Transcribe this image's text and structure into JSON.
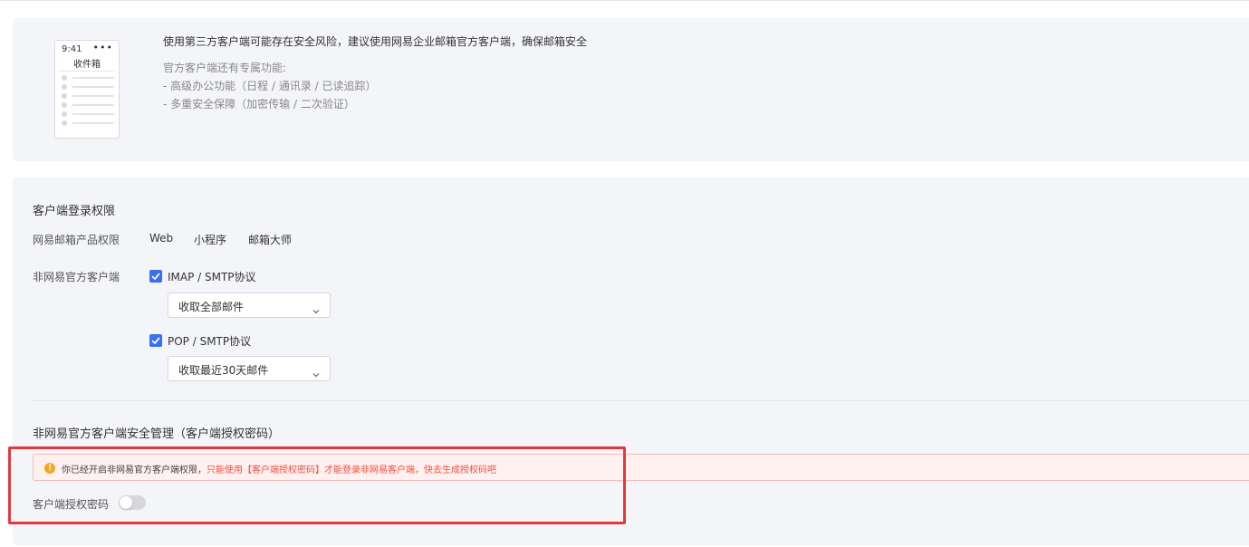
{
  "recommend": {
    "phone": {
      "time": "9:41",
      "menu": "•••",
      "title": "收件箱"
    },
    "headline": "使用第三方客户端可能存在安全风险，建议使用网易企业邮箱官方客户端，确保邮箱安全",
    "features_intro": "官方客户端还有专属功能:",
    "features": [
      "- 高级办公功能（日程 / 通讯录 / 已读追踪）",
      "- 多重安全保障（加密传输 / 二次验证）"
    ]
  },
  "login_permissions": {
    "title": "客户端登录权限",
    "product_label": "网易邮箱产品权限",
    "products": [
      "Web",
      "小程序",
      "邮箱大师"
    ],
    "third_party_label": "非网易官方客户端",
    "protocols": [
      {
        "label": "IMAP / SMTP协议",
        "checked": true,
        "fetch_option": "收取全部邮件"
      },
      {
        "label": "POP / SMTP协议",
        "checked": true,
        "fetch_option": "收取最近30天邮件"
      }
    ]
  },
  "security": {
    "title": "非网易官方客户端安全管理（客户端授权密码）",
    "alert_normal": "你已经开启非网易官方客户端权限，",
    "alert_warning": "只能使用【客户端授权密码】才能登录非网易客户端，快去生成授权码吧",
    "auth_password_label": "客户端授权密码",
    "auth_password_enabled": false
  },
  "colors": {
    "accent": "#386ff5",
    "warning": "#f5a623",
    "alert_text": "#f04f3f",
    "highlight": "#e5383b"
  }
}
